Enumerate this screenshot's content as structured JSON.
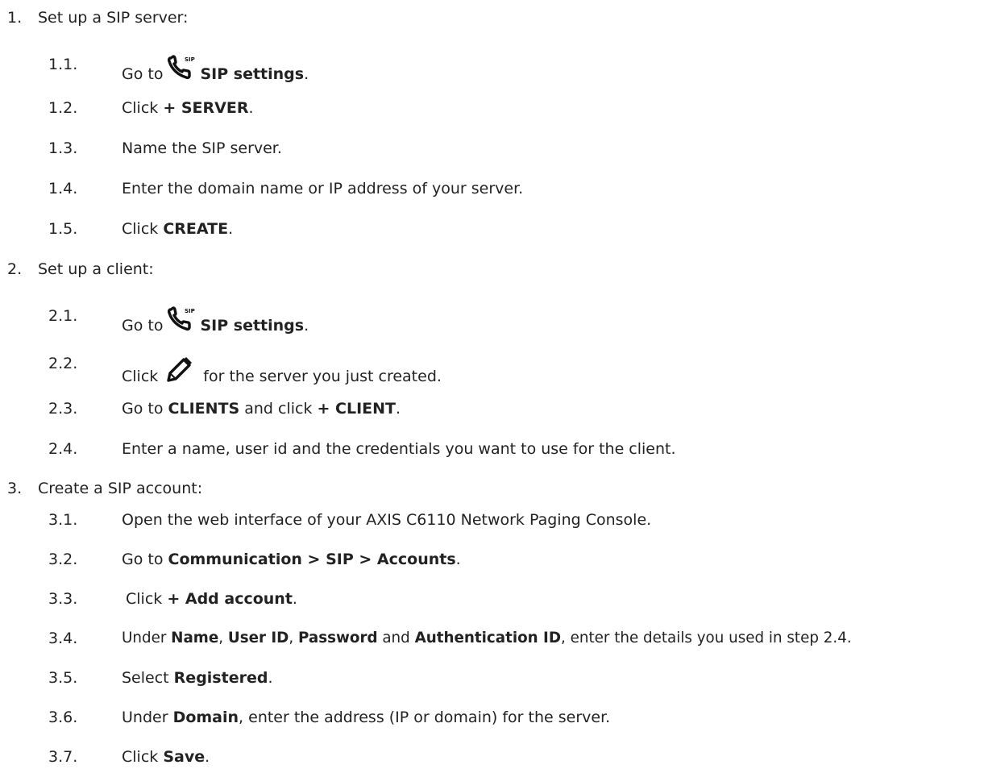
{
  "steps": [
    {
      "number": "1.",
      "text": "Set up a SIP server:",
      "substeps": [
        {
          "number": "1.1.",
          "pre": "Go to",
          "icon": "sip-phone-icon",
          "bold": "SIP settings",
          "post": "."
        },
        {
          "number": "1.2.",
          "pre": "Click",
          "bold": "+ SERVER",
          "post": "."
        },
        {
          "number": "1.3.",
          "text": "Name the SIP server."
        },
        {
          "number": "1.4.",
          "text": "Enter the domain name or IP address of your server."
        },
        {
          "number": "1.5.",
          "pre": "Click",
          "bold": "CREATE",
          "post": "."
        }
      ]
    },
    {
      "number": "2.",
      "text": "Set up a client:",
      "substeps": [
        {
          "number": "2.1.",
          "pre": "Go to",
          "icon": "sip-phone-icon",
          "bold": "SIP settings",
          "post": "."
        },
        {
          "number": "2.2.",
          "pre": "Click",
          "icon": "pencil-icon",
          "post": "for the server you just created."
        },
        {
          "number": "2.3.",
          "pre": "Go to",
          "bold": "CLIENTS",
          "mid": "and click",
          "bold2": "+ CLIENT",
          "post": "."
        },
        {
          "number": "2.4.",
          "text": "Enter a name, user id and the credentials you want to use for the client."
        }
      ]
    },
    {
      "number": "3.",
      "text": "Create a SIP account:",
      "substeps": [
        {
          "number": "3.1.",
          "text": "Open the web interface of your AXIS C6110 Network Paging Console."
        },
        {
          "number": "3.2.",
          "pre": "Go to",
          "bold": "Communication > SIP > Accounts",
          "post": "."
        },
        {
          "number": "3.3.",
          "pre": "Click",
          "bold": "+ Add account",
          "post": "."
        },
        {
          "number": "3.4.",
          "pre": "Under",
          "bold": "Name",
          "sep1": ",",
          "bold2": "User ID",
          "sep2": ",",
          "bold3": "Password",
          "mid": "and",
          "bold4": "Authentication ID",
          "post": ", enter the details you used in step 2.4."
        },
        {
          "number": "3.5.",
          "pre": "Select",
          "bold": "Registered",
          "post": "."
        },
        {
          "number": "3.6.",
          "pre": "Under",
          "bold": "Domain",
          "post": ", enter the address (IP or domain) for the server."
        },
        {
          "number": "3.7.",
          "pre": "Click",
          "bold": "Save",
          "post": "."
        }
      ]
    }
  ],
  "icons": {
    "sip_label": "SIP"
  }
}
